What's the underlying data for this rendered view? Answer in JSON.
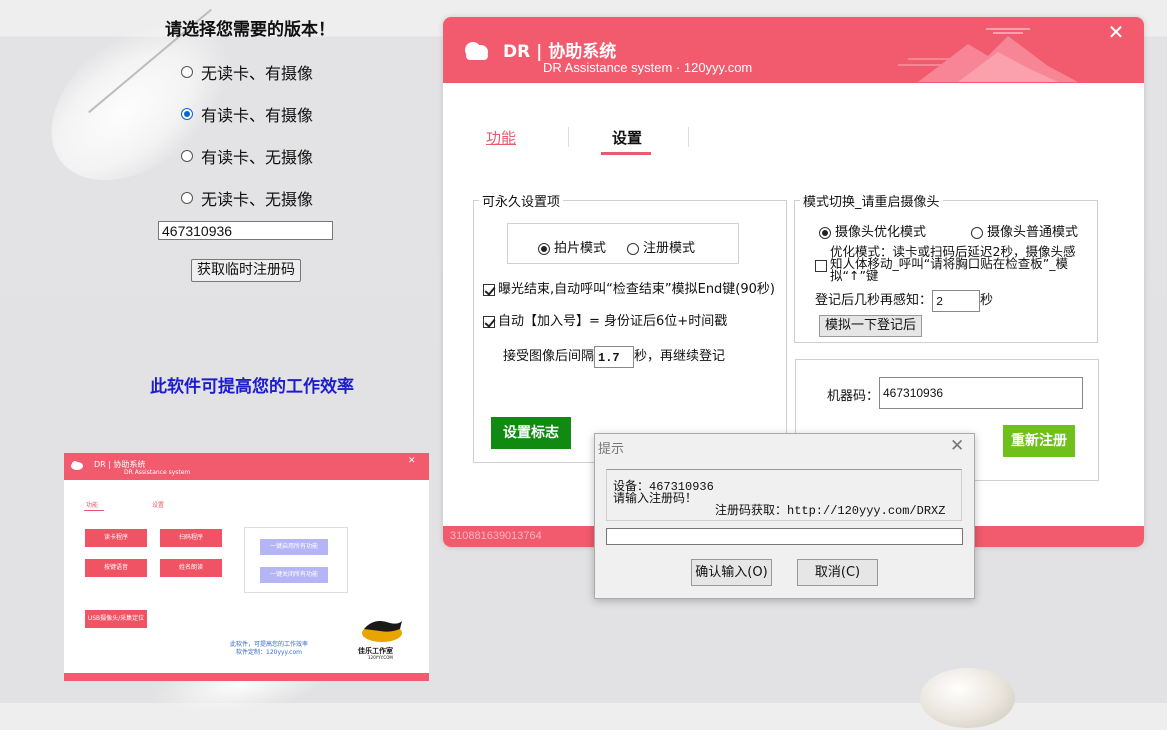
{
  "left_page": {
    "title": "请选择您需要的版本！",
    "options": [
      {
        "label": "无读卡、有摄像",
        "selected": false
      },
      {
        "label": "有读卡、有摄像",
        "selected": true
      },
      {
        "label": "有读卡、无摄像",
        "selected": false
      },
      {
        "label": "无读卡、无摄像",
        "selected": false
      }
    ],
    "code_value": "467310936",
    "get_code_button": "获取临时注册码",
    "promo_text": "此软件可提高您的工作效率",
    "promo_color": "#1c1ccf"
  },
  "thumbnail": {
    "title": "DR | 协助系统",
    "subtitle": "DR Assistance system",
    "tab_func": "功能",
    "tab_set": "设置",
    "buttons": [
      "读卡程序",
      "扫码程序",
      "按键语音",
      "姓名朗读",
      "USB摄像头/采集定位"
    ],
    "right_buttons": [
      "一键启用所有功能",
      "一键关闭所有功能"
    ],
    "promo_line1": "此软件，可提高您的工作效率",
    "promo_line2": "软件定制：120yyy.com",
    "logo_text": "佳乐工作室",
    "logo_url": "120YYY.COM"
  },
  "window": {
    "title": "DR | 协助系统",
    "subtitle": "DR Assistance system · 120yyy.com",
    "brand_color": "#f25a6e",
    "tabs": {
      "func": "功能",
      "settings": "设置"
    },
    "persistent": {
      "legend": "可永久设置项",
      "mode_photo": "拍片模式",
      "mode_register": "注册模式",
      "selected_mode": "photo",
      "exposure_label": "曝光结束,自动呼叫“检查结束”模拟End键(90秒)",
      "exposure_checked": true,
      "auto_add_label": "自动【加入号】= 身份证后6位+时间戳",
      "auto_add_checked": true,
      "interval_prefix": "接受图像后间隔",
      "interval_value": "1.7",
      "interval_suffix": "秒，再继续登记",
      "set_flag_button": "设置标志"
    },
    "mode_switch": {
      "legend": "模式切换_请重启摄像头",
      "opt_optimized": "摄像头优化模式",
      "opt_normal": "摄像头普通模式",
      "selected": "optimized",
      "optimize_line1": "优化模式：读卡或扫码后延迟2秒，摄像头感",
      "optimize_line2": "知人体移动_呼叫“请将胸口贴在检查板”_模",
      "optimize_line3": "拟“↑”键",
      "optimize_checked": false,
      "sense_prefix": "登记后几秒再感知：",
      "sense_value": "2",
      "sense_suffix": "秒",
      "simulate_button": "模拟一下登记后"
    },
    "machine": {
      "label": "机器码：",
      "value": "467310936",
      "reregister_button": "重新注册"
    },
    "footer_text": "310881639013764"
  },
  "dialog": {
    "title": "提示",
    "line1": "设备：467310936",
    "line2": "请输入注册码！",
    "line3": "注册码获取：http://120yyy.com/DRXZ",
    "input_value": "",
    "ok_button": "确认输入(O)",
    "cancel_button": "取消(C)"
  }
}
